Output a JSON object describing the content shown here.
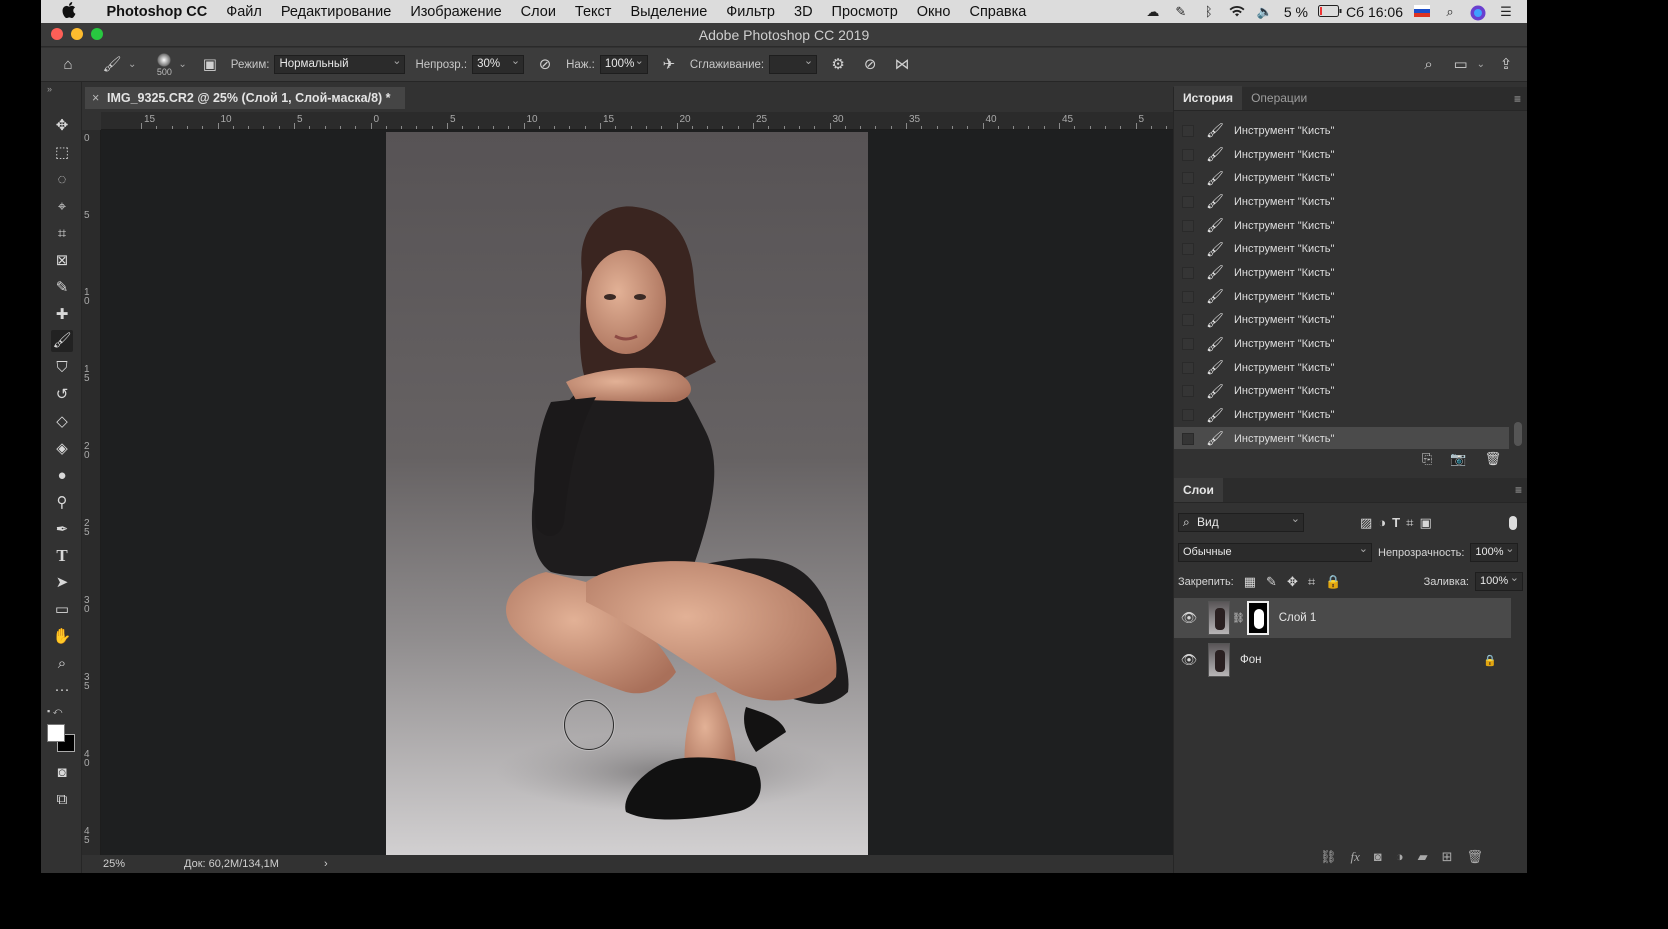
{
  "menubar": {
    "apple": "",
    "items": [
      "Photoshop CC",
      "Файл",
      "Редактирование",
      "Изображение",
      "Слои",
      "Текст",
      "Выделение",
      "Фильтр",
      "3D",
      "Просмотр",
      "Окно",
      "Справка"
    ],
    "battery": "5 %",
    "clock": "Сб 16:06"
  },
  "window": {
    "title": "Adobe Photoshop CC 2019"
  },
  "options": {
    "brush_size": "500",
    "mode_label": "Режим:",
    "mode_value": "Нормальный",
    "opacity_label": "Непрозр.:",
    "opacity_value": "30%",
    "flow_label": "Наж.:",
    "flow_value": "100%",
    "smoothing_label": "Сглаживание:",
    "smoothing_value": ""
  },
  "document": {
    "tab_close": "×",
    "tab_title": "IMG_9325.CR2 @ 25% (Слой 1, Слой-маска/8) *",
    "zoom": "25%",
    "doc_info": "Док: 60,2M/134,1M",
    "status_arrow": "›"
  },
  "ruler": {
    "h_labels": [
      "15",
      "10",
      "5",
      "0",
      "5",
      "10",
      "15",
      "20",
      "25",
      "30",
      "35",
      "40",
      "45",
      "5"
    ],
    "v_labels": [
      "0",
      "5",
      "1 0",
      "1 5",
      "2 0",
      "2 5",
      "3 0",
      "3 5",
      "4 0",
      "4 5"
    ]
  },
  "history_panel": {
    "tabs": [
      "История",
      "Операции"
    ],
    "items": [
      "Инструмент \"Кисть\"",
      "Инструмент \"Кисть\"",
      "Инструмент \"Кисть\"",
      "Инструмент \"Кисть\"",
      "Инструмент \"Кисть\"",
      "Инструмент \"Кисть\"",
      "Инструмент \"Кисть\"",
      "Инструмент \"Кисть\"",
      "Инструмент \"Кисть\"",
      "Инструмент \"Кисть\"",
      "Инструмент \"Кисть\"",
      "Инструмент \"Кисть\"",
      "Инструмент \"Кисть\"",
      "Инструмент \"Кисть\""
    ],
    "selected_index": 13
  },
  "layers_panel": {
    "title": "Слои",
    "filter_value": "Вид",
    "blend_value": "Обычные",
    "opacity_label": "Непрозрачность:",
    "opacity_value": "100%",
    "lock_label": "Закрепить:",
    "fill_label": "Заливка:",
    "fill_value": "100%",
    "layers": [
      {
        "name": "Слой 1",
        "visible": true,
        "selected": true,
        "has_mask": true
      },
      {
        "name": "Фон",
        "visible": true,
        "selected": false,
        "locked": true
      }
    ]
  },
  "colors": {
    "accent_red": "#fe5f57",
    "accent_yellow": "#febc2e",
    "accent_green": "#28c840"
  }
}
